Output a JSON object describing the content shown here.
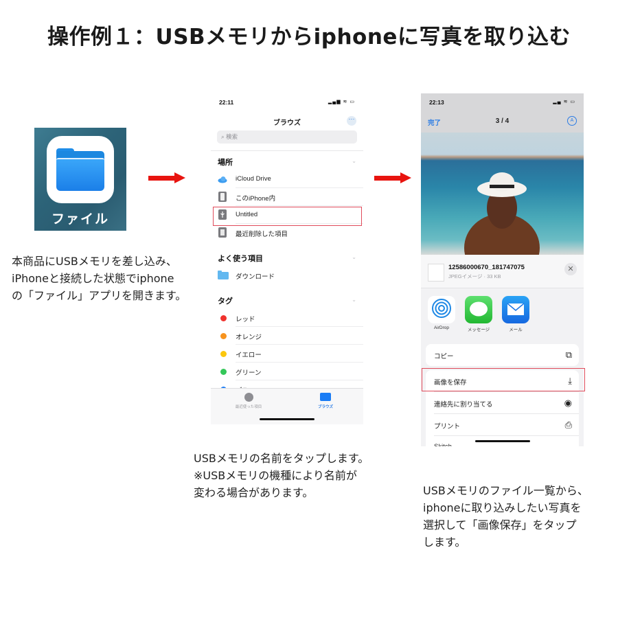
{
  "title": "操作例１：USBメモリからiphoneに写真を取り込む",
  "step1": {
    "app_label": "ファイル",
    "description": "本商品にUSBメモリを差し込み、\niPhoneと接続した状態でiphone\nの「ファイル」アプリを開きます。"
  },
  "step2": {
    "status_time": "22:11",
    "nav_title": "ブラウズ",
    "search_placeholder": "検索",
    "sections": {
      "locations": {
        "header": "場所",
        "items": [
          {
            "label": "iCloud Drive",
            "icon": "icloud-icon"
          },
          {
            "label": "このiPhone内",
            "icon": "iphone-icon"
          },
          {
            "label": "Untitled",
            "icon": "usb-icon",
            "highlighted": true
          },
          {
            "label": "最近削除した項目",
            "icon": "trash-icon"
          }
        ]
      },
      "favorites": {
        "header": "よく使う項目",
        "items": [
          {
            "label": "ダウンロード",
            "icon": "folder-icon"
          }
        ]
      },
      "tags": {
        "header": "タグ",
        "items": [
          {
            "label": "レッド",
            "color": "#f0322d"
          },
          {
            "label": "オレンジ",
            "color": "#f7931e"
          },
          {
            "label": "イエロー",
            "color": "#fbc70d"
          },
          {
            "label": "グリーン",
            "color": "#34c759"
          },
          {
            "label": "ブル",
            "color": "#1a7cf5"
          }
        ]
      }
    },
    "tabbar": {
      "recents_label": "最近使った項目",
      "browse_label": "ブラウズ"
    },
    "description": "USBメモリの名前をタップします。\n※USBメモリの機種により名前が\n変わる場合があります。"
  },
  "step3": {
    "status_time": "22:13",
    "done_label": "完了",
    "counter": "3 / 4",
    "file": {
      "name": "12586000670_181747075",
      "meta": "JPEGイメージ · 33 KB"
    },
    "share_apps": [
      {
        "label": "AirDrop"
      },
      {
        "label": "メッセージ"
      },
      {
        "label": "メール"
      }
    ],
    "actions": [
      {
        "label": "コピー",
        "icon": "⧉"
      },
      {
        "label": "画像を保存",
        "icon": "⤓",
        "highlighted": true
      },
      {
        "label": "連絡先に割り当てる",
        "icon": "◉"
      },
      {
        "label": "プリント",
        "icon": "⎙"
      },
      {
        "label": "Skitch",
        "icon": "◡"
      }
    ],
    "description": "USBメモリのファイル一覧から、\niphoneに取り込みしたい写真を\n選択して「画像保存」をタップ\nします。"
  },
  "colors": {
    "arrow": "#e8140f",
    "highlight": "#e04a5a",
    "ios_blue": "#2a7be4"
  }
}
